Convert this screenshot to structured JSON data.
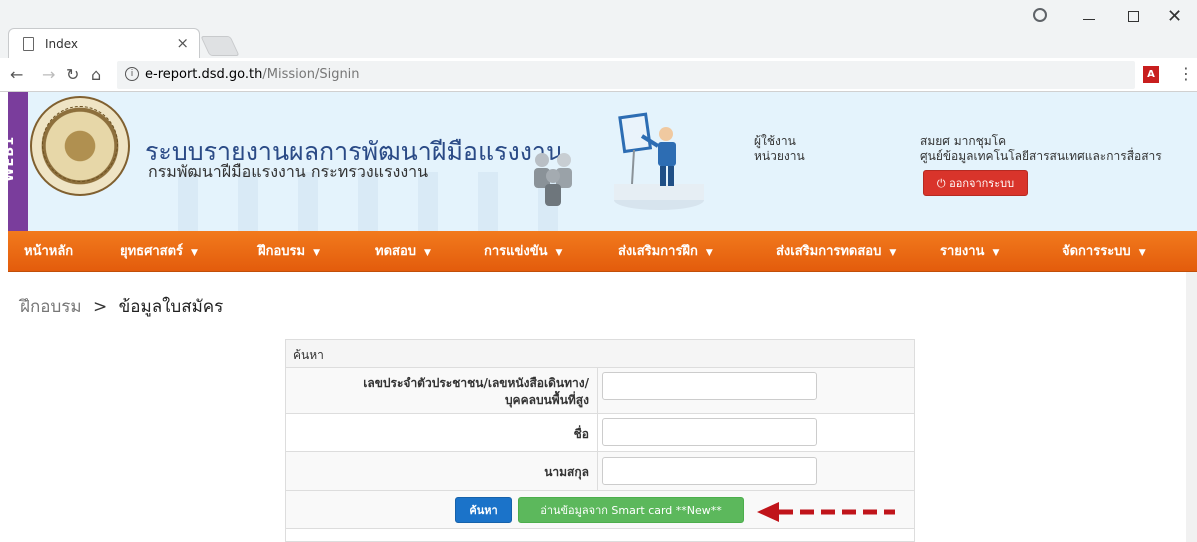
{
  "browser": {
    "tab_title": "Index",
    "tab_close": "×",
    "url_host": "e-report.dsd.go.th",
    "url_path": "/Mission/Signin",
    "star": "☆",
    "menu": "⋮",
    "pdf_label": "A"
  },
  "header": {
    "side_badge": "WEB1",
    "title": "ระบบรายงานผลการพัฒนาฝีมือแรงงาน",
    "subtitle": "กรมพัฒนาฝีมือแรงงาน กระทรวงแรงงาน",
    "user_label": "ผู้ใช้งาน",
    "unit_label": "หน่วยงาน",
    "user_name": "สมยศ มากชุมโค",
    "unit_name": "ศูนย์ข้อมูลเทคโนโลยีสารสนเทศและการสื่อสาร",
    "logout_label": "ออกจากระบบ"
  },
  "nav": {
    "items": [
      {
        "label": "หน้าหลัก"
      },
      {
        "label": "ยุทธศาสตร์"
      },
      {
        "label": "ฝึกอบรม"
      },
      {
        "label": "ทดสอบ"
      },
      {
        "label": "การแข่งขัน"
      },
      {
        "label": "ส่งเสริมการฝึก"
      },
      {
        "label": "ส่งเสริมการทดสอบ"
      },
      {
        "label": "รายงาน"
      },
      {
        "label": "จัดการระบบ"
      }
    ]
  },
  "breadcrumb": {
    "parent": "ฝึกอบรม",
    "separator": ">",
    "current": "ข้อมูลใบสมัคร"
  },
  "search_panel": {
    "heading": "ค้นหา",
    "id_label_line1": "เลขประจำตัวประชาชน/เลขหนังสือเดินทาง/",
    "id_label_line2": "บุคคลบนพื้นที่สูง",
    "id_value": "",
    "first_name_label": "ชื่อ",
    "first_name_value": "",
    "last_name_label": "นามสกุล",
    "last_name_value": "",
    "search_button": "ค้นหา",
    "smartcard_button": "อ่านข้อมูลจาก Smart card **New**"
  },
  "colors": {
    "nav_bg": "#e8620f",
    "header_bg": "#e4f3fc",
    "badge_bg": "#7a3d9c",
    "search_btn": "#1b73c9",
    "smartcard_btn": "#5cb85c",
    "logout_btn": "#d9342b",
    "arrow": "#c0141a"
  }
}
